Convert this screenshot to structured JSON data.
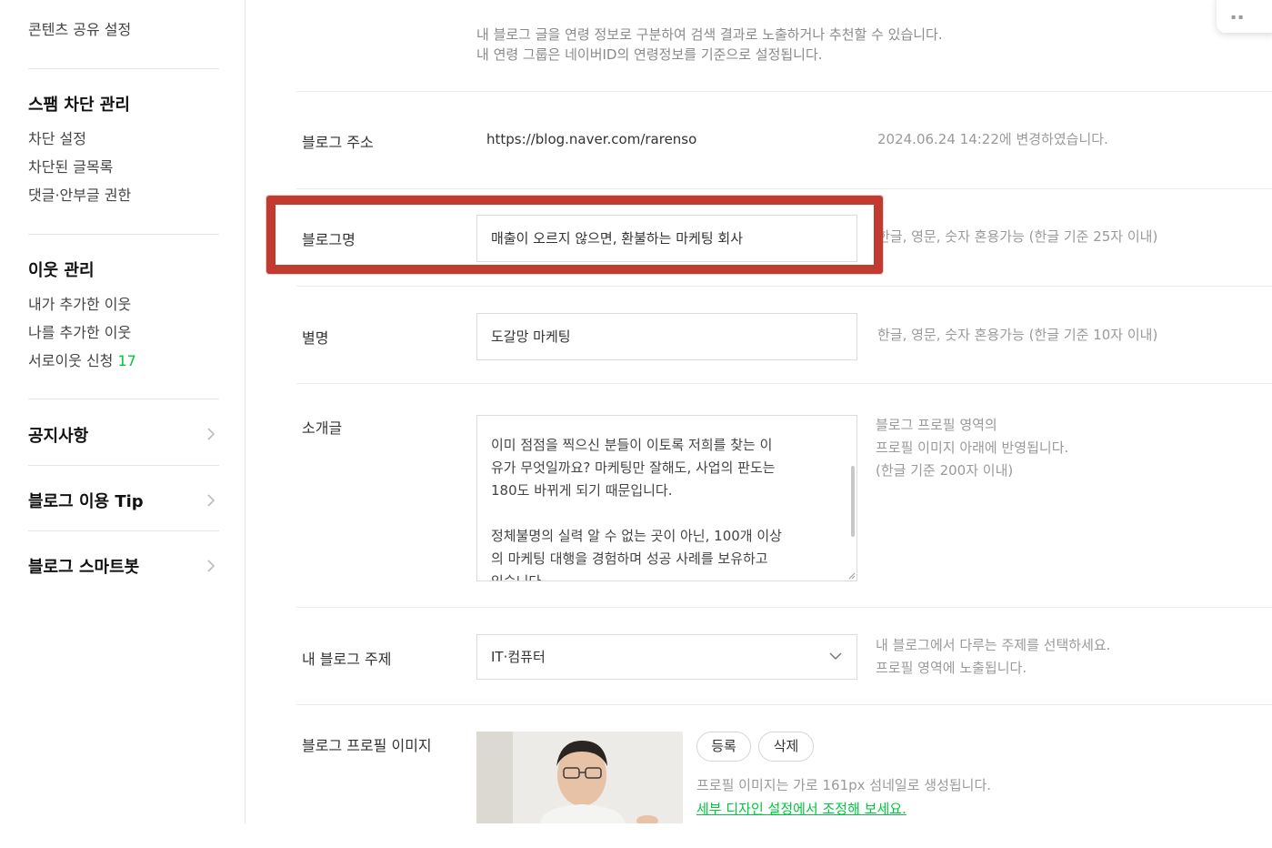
{
  "sidebar": {
    "content_share": "콘텐츠 공유 설정",
    "spam": {
      "heading": "스팸 차단 관리",
      "items": [
        "차단 설정",
        "차단된 글목록",
        "댓글·안부글 권한"
      ]
    },
    "neighbors": {
      "heading": "이웃 관리",
      "items": [
        "내가 추가한 이웃",
        "나를 추가한 이웃",
        "서로이웃 신청"
      ],
      "request_count": "17"
    },
    "links": [
      "공지사항",
      "블로그 이용 Tip",
      "블로그 스마트봇"
    ]
  },
  "main": {
    "age_info": [
      "내 블로그 글을 연령 정보로 구분하여 검색 결과로 노출하거나 추천할 수 있습니다.",
      "내 연령 그룹은 네이버ID의 연령정보를 기준으로 설정됩니다."
    ],
    "blog_address": {
      "label": "블로그 주소",
      "value": "https://blog.naver.com/rarenso",
      "note": "2024.06.24 14:22에 변경하였습니다."
    },
    "blog_name": {
      "label": "블로그명",
      "value": "매출이 오르지 않으면, 환불하는 마케팅 회사",
      "note": "한글, 영문, 숫자 혼용가능 (한글 기준 25자 이내)"
    },
    "nickname": {
      "label": "별명",
      "value": "도갈망 마케팅",
      "note": "한글, 영문, 숫자 혼용가능 (한글 기준 10자 이내)"
    },
    "intro": {
      "label": "소개글",
      "lines": [
        "이미 점점을 찍으신 분들이 이토록 저희를 찾는 이",
        "유가 무엇일까요? 마케팅만 잘해도, 사업의 판도는",
        "180도 바뀌게 되기 때문입니다.",
        "",
        "정체불명의 실력 알 수 없는 곳이 아닌, 100개 이상",
        "의 마케팅 대행을 경험하며 성공 사례를 보유하고",
        "있습니다."
      ],
      "note": [
        "블로그 프로필 영역의",
        "프로필 이미지 아래에 반영됩니다.",
        "(한글 기준 200자 이내)"
      ]
    },
    "topic": {
      "label": "내 블로그 주제",
      "value": "IT·컴퓨터",
      "note": [
        "내 블로그에서 다루는 주제를 선택하세요.",
        "프로필 영역에 노출됩니다."
      ]
    },
    "profile_image": {
      "label": "블로그 프로필 이미지",
      "register_button": "등록",
      "delete_button": "삭제",
      "note": "프로필 이미지는 가로 161px 섬네일로 생성됩니다.",
      "link": "세부 디자인 설정에서 조정해 보세요."
    }
  },
  "colors": {
    "highlight": "#c23b31",
    "accent_green": "#00c73c"
  }
}
